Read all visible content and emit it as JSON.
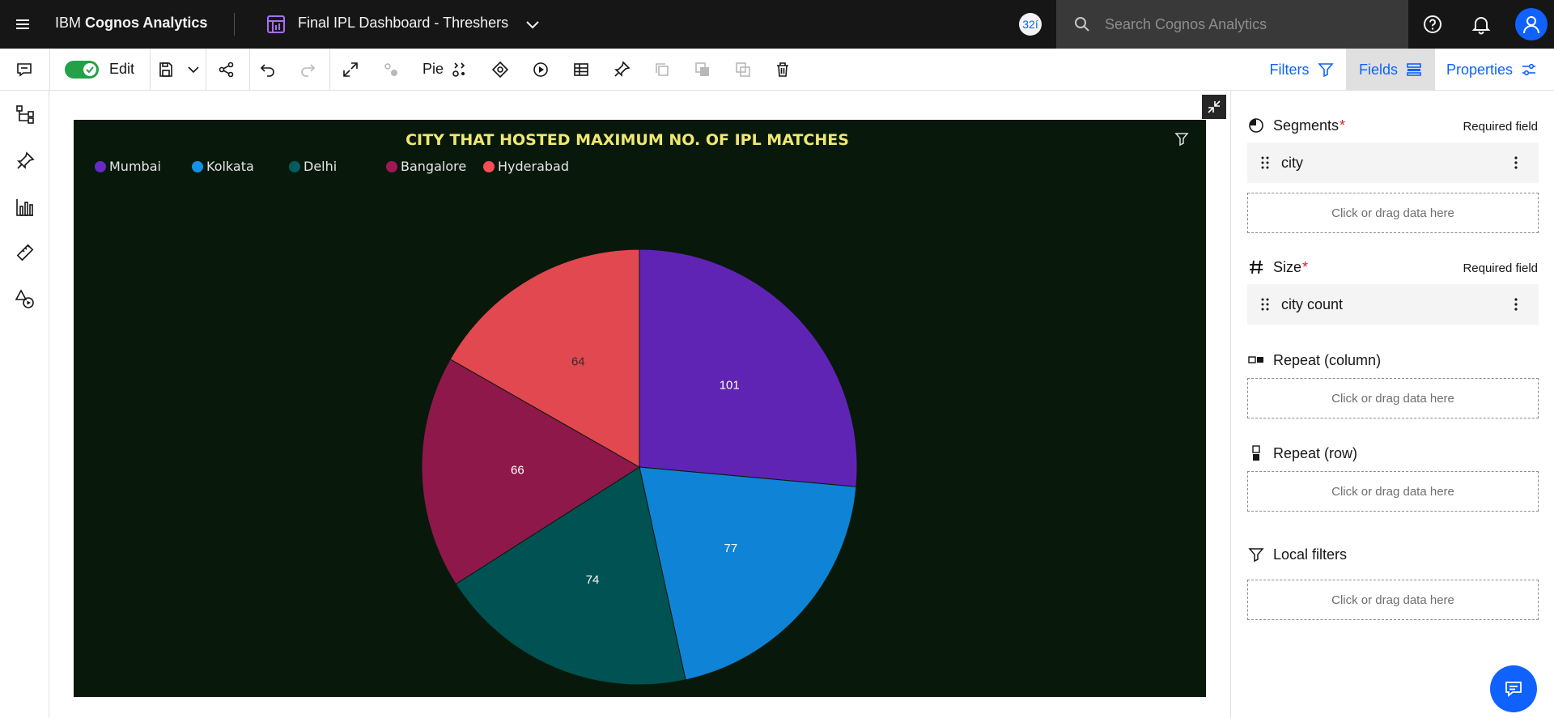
{
  "topbar": {
    "brand_prefix": "IBM",
    "brand_name": "Cognos Analytics",
    "dashboard_title": "Final IPL Dashboard - Threshers",
    "badge": "32í",
    "search_placeholder": "Search Cognos Analytics"
  },
  "toolbar": {
    "edit_label": "Edit",
    "chart_type_label": "Pie",
    "filters_label": "Filters",
    "fields_label": "Fields",
    "properties_label": "Properties"
  },
  "chart": {
    "title": "CITY THAT HOSTED MAXIMUM NO. OF IPL MATCHES",
    "legend": [
      {
        "label": "Mumbai",
        "color": "#6929c4"
      },
      {
        "label": "Kolkata",
        "color": "#1192e8"
      },
      {
        "label": "Delhi",
        "color": "#005d5d"
      },
      {
        "label": "Bangalore",
        "color": "#9f1853"
      },
      {
        "label": "Hyderabad",
        "color": "#fa4d56"
      }
    ]
  },
  "chart_data": {
    "type": "pie",
    "title": "CITY THAT HOSTED MAXIMUM NO. OF IPL MATCHES",
    "categories": [
      "Mumbai",
      "Kolkata",
      "Delhi",
      "Bangalore",
      "Hyderabad"
    ],
    "values": [
      101,
      77,
      74,
      66,
      64
    ],
    "colors": [
      "#5f24b4",
      "#0f84d6",
      "#005352",
      "#8e1849",
      "#e2484f"
    ],
    "legend_position": "top-left",
    "data_labels": true
  },
  "fields_panel": {
    "segments": {
      "title": "Segments",
      "required": "Required field",
      "field": "city"
    },
    "size": {
      "title": "Size",
      "required": "Required field",
      "field": "city count"
    },
    "repeat_column": {
      "title": "Repeat (column)"
    },
    "repeat_row": {
      "title": "Repeat (row)"
    },
    "local_filters": {
      "title": "Local filters"
    },
    "drop_placeholder": "Click or drag data here"
  }
}
